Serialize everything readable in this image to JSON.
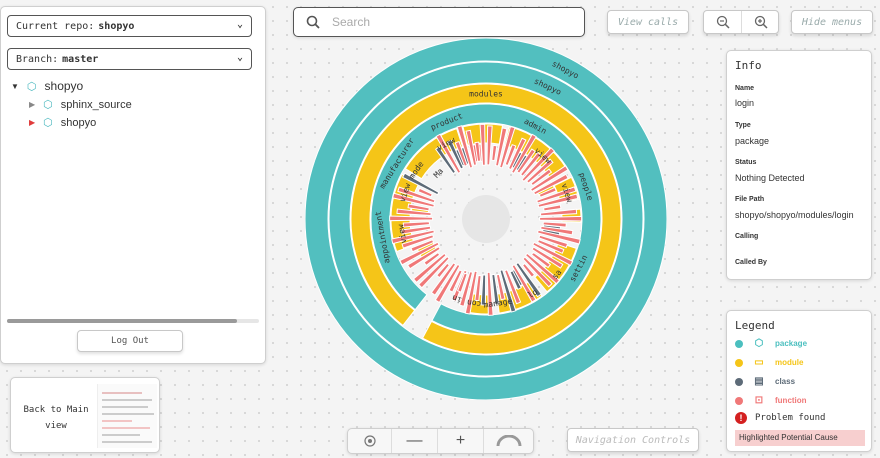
{
  "left_panel": {
    "repo_label": "Current repo:",
    "repo_value": "shopyo",
    "branch_label": "Branch:",
    "branch_value": "master",
    "tree": [
      {
        "label": "shopyo",
        "expanded": true,
        "triangle": "▼",
        "triangle_color": "#222"
      },
      {
        "label": "sphinx_source",
        "triangle": "▶",
        "triangle_color": "#888"
      },
      {
        "label": "shopyo",
        "triangle": "▶",
        "triangle_color": "#e03c3c"
      }
    ],
    "logout_label": "Log Out"
  },
  "back_card": {
    "label": "Back to Main view"
  },
  "search": {
    "placeholder": "Search"
  },
  "toolbar": {
    "view_calls": "View calls",
    "hide_menus": "Hide menus",
    "zoom_out_icon": "zoom-out-icon",
    "zoom_in_icon": "zoom-in-icon"
  },
  "info": {
    "title": "Info",
    "fields": [
      {
        "label": "Name",
        "value": "login"
      },
      {
        "label": "Type",
        "value": "package"
      },
      {
        "label": "Status",
        "value": "Nothing Detected"
      },
      {
        "label": "File Path",
        "value": "shopyo/shopyo/modules/login"
      },
      {
        "label": "Calling",
        "value": ""
      },
      {
        "label": "Called By",
        "value": ""
      }
    ]
  },
  "legend": {
    "title": "Legend",
    "items": [
      {
        "label": "package",
        "color": "#4bbfbf",
        "icon": "cube-icon"
      },
      {
        "label": "module",
        "color": "#f5c518",
        "icon": "folder-icon"
      },
      {
        "label": "class",
        "color": "#5d6b78",
        "icon": "document-icon"
      },
      {
        "label": "function",
        "color": "#f07878",
        "icon": "function-icon"
      }
    ],
    "problem_label": "Problem found",
    "highlight_label": "Highlighted Potential Cause"
  },
  "nav": {
    "label": "Navigation Controls"
  },
  "sunburst": {
    "colors": {
      "package": "#52bfbf",
      "module": "#f5c518",
      "class": "#5d6b78",
      "function": "#f07878",
      "center": "#e6e6e6"
    },
    "labels": [
      "shopyo",
      "shopyo",
      "modules",
      "product",
      "admin",
      "view",
      "view",
      "mode",
      "Ma",
      "manufacturer",
      "view",
      "appointment",
      "view",
      "people",
      "view",
      "settin",
      "sa",
      "lo",
      "manage",
      "con",
      "in"
    ]
  }
}
